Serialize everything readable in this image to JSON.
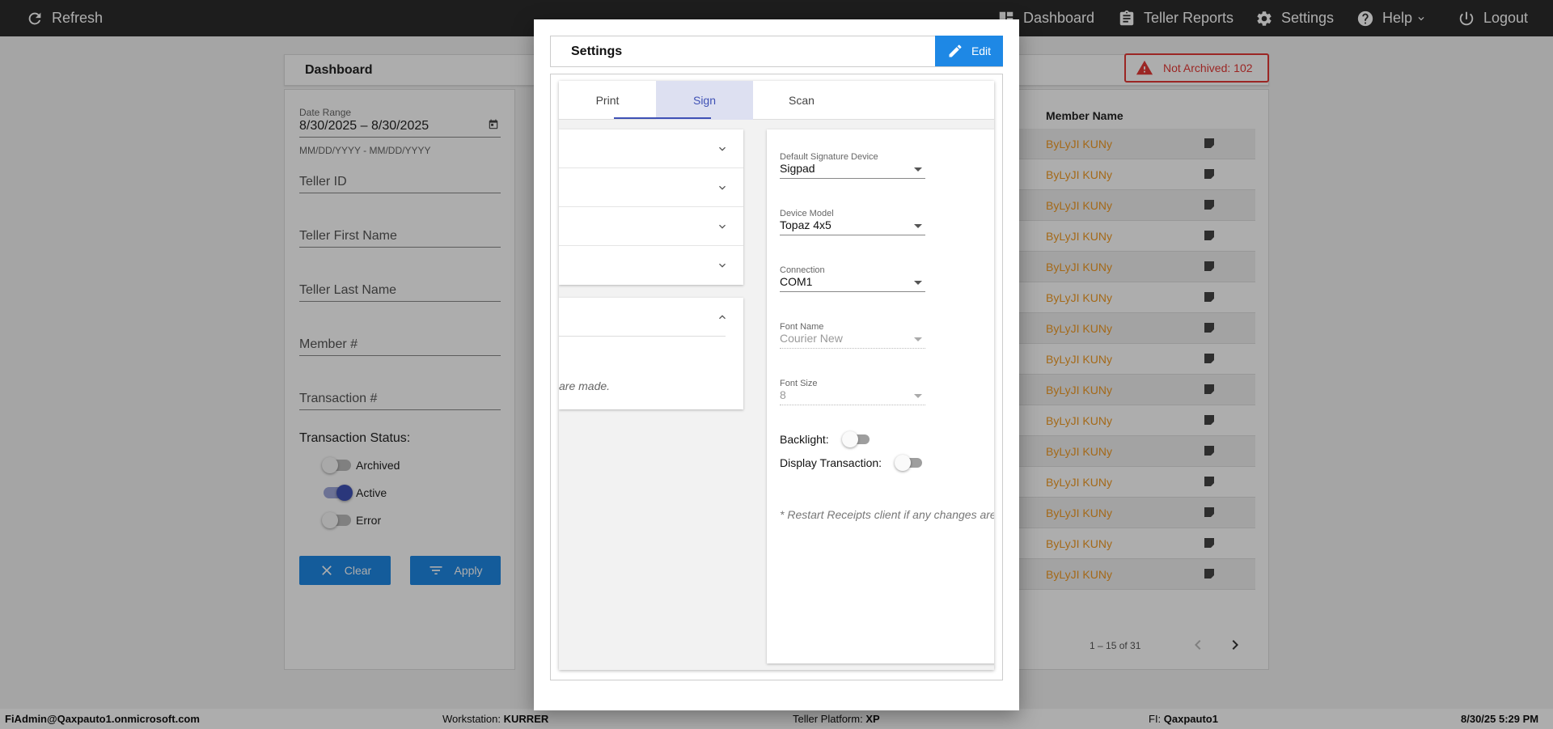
{
  "topbar": {
    "refresh": "Refresh",
    "dashboard": "Dashboard",
    "teller_reports": "Teller Reports",
    "settings": "Settings",
    "help": "Help",
    "logout": "Logout"
  },
  "dashboard": {
    "title": "Dashboard",
    "not_archived": "Not Archived: 102"
  },
  "filters": {
    "date_range_label": "Date Range",
    "date_range_value": "8/30/2025 – 8/30/2025",
    "date_hint": "MM/DD/YYYY - MM/DD/YYYY",
    "teller_id": "Teller ID",
    "teller_first_name": "Teller First Name",
    "teller_last_name": "Teller Last Name",
    "member_no": "Member #",
    "transaction_no": "Transaction #",
    "transaction_status": "Transaction Status:",
    "statuses": [
      {
        "label": "Archived",
        "on": false
      },
      {
        "label": "Active",
        "on": true
      },
      {
        "label": "Error",
        "on": false
      }
    ],
    "clear": "Clear",
    "apply": "Apply"
  },
  "table": {
    "col_member_name": "Member Name",
    "rows": [
      "ByLyJI KUNy",
      "ByLyJI KUNy",
      "ByLyJI KUNy",
      "ByLyJI KUNy",
      "ByLyJI KUNy",
      "ByLyJI KUNy",
      "ByLyJI KUNy",
      "ByLyJI KUNy",
      "ByLyJI KUNy",
      "ByLyJI KUNy",
      "ByLyJI KUNy",
      "ByLyJI KUNy",
      "ByLyJI KUNy",
      "ByLyJI KUNy",
      "ByLyJI KUNy"
    ],
    "pagination": "1 – 15 of 31"
  },
  "statusbar": {
    "user": "FiAdmin@Qaxpauto1.onmicrosoft.com",
    "workstation_label": "Workstation:",
    "workstation": "KURRER",
    "platform_label": "Teller Platform:",
    "platform": "XP",
    "fi_label": "FI:",
    "fi": "Qaxpauto1",
    "datetime": "8/30/25 5:29 PM"
  },
  "modal": {
    "title": "Settings",
    "edit": "Edit",
    "tabs": [
      "Print",
      "Sign",
      "Scan"
    ],
    "active_tab": "Sign",
    "left_note": "are made.",
    "sign": {
      "default_device_label": "Default Signature Device",
      "default_device": "Sigpad",
      "device_model_label": "Device Model",
      "device_model": "Topaz 4x5",
      "connection_label": "Connection",
      "connection": "COM1",
      "font_name_label": "Font Name",
      "font_name": "Courier New",
      "font_size_label": "Font Size",
      "font_size": "8",
      "backlight": "Backlight:",
      "display_transaction": "Display Transaction:",
      "restart_note": "* Restart Receipts client if any changes are made."
    }
  },
  "colors": {
    "accent": "#1e88e5",
    "indigo": "#3f51b5",
    "link": "#f29b24",
    "alert": "#e53935",
    "topbar": "#2b2b2b"
  }
}
